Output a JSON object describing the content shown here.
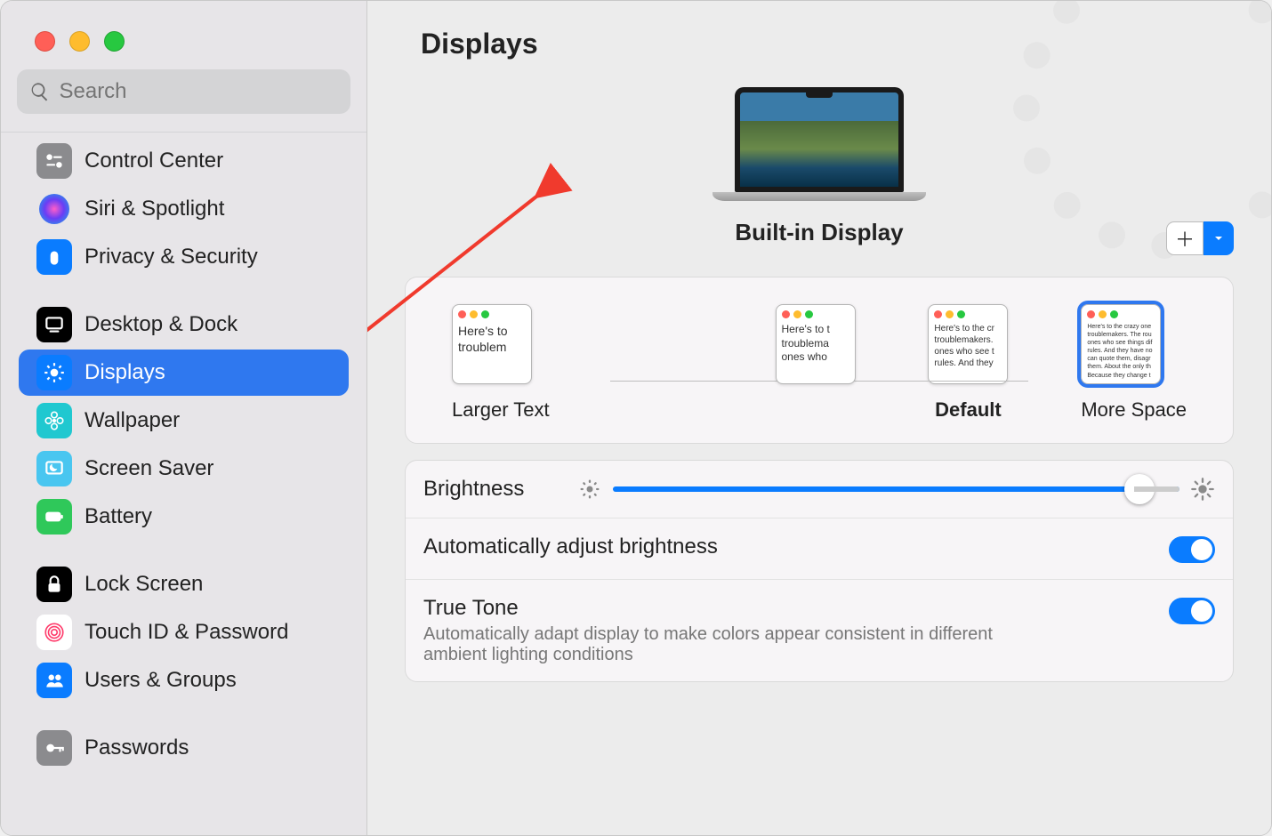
{
  "window": {
    "search_placeholder": "Search",
    "title": "Displays"
  },
  "sidebar": {
    "items": [
      {
        "label": "Control Center",
        "id": "control-center"
      },
      {
        "label": "Siri & Spotlight",
        "id": "siri-spotlight"
      },
      {
        "label": "Privacy & Security",
        "id": "privacy-security"
      },
      {
        "label": "Desktop & Dock",
        "id": "desktop-dock"
      },
      {
        "label": "Displays",
        "id": "displays",
        "selected": true
      },
      {
        "label": "Wallpaper",
        "id": "wallpaper"
      },
      {
        "label": "Screen Saver",
        "id": "screen-saver"
      },
      {
        "label": "Battery",
        "id": "battery"
      },
      {
        "label": "Lock Screen",
        "id": "lock-screen"
      },
      {
        "label": "Touch ID & Password",
        "id": "touch-id"
      },
      {
        "label": "Users & Groups",
        "id": "users-groups"
      },
      {
        "label": "Passwords",
        "id": "passwords"
      }
    ]
  },
  "display": {
    "name": "Built-in Display",
    "add_plus": "＋"
  },
  "resolutions": {
    "larger_label": "Larger Text",
    "default_label": "Default",
    "more_space_label": "More Space",
    "preview_text_large": "Here's to\ntroublem",
    "preview_text_med": "Here's to t\ntroublema\nones who",
    "preview_text_default": "Here's to the cr\ntroublemakers.\nones who see t\nrules. And they",
    "preview_text_small": "Here's to the crazy one\ntroublemakers. The rou\nones who see things dif\nrules. And they have no\ncan quote them, disagr\nthem. About the only th\nBecause they change t"
  },
  "settings": {
    "brightness_label": "Brightness",
    "brightness_percent": 92,
    "auto_brightness_label": "Automatically adjust brightness",
    "auto_brightness_on": true,
    "true_tone_label": "True Tone",
    "true_tone_desc": "Automatically adapt display to make colors appear consistent in different ambient lighting conditions",
    "true_tone_on": true
  }
}
